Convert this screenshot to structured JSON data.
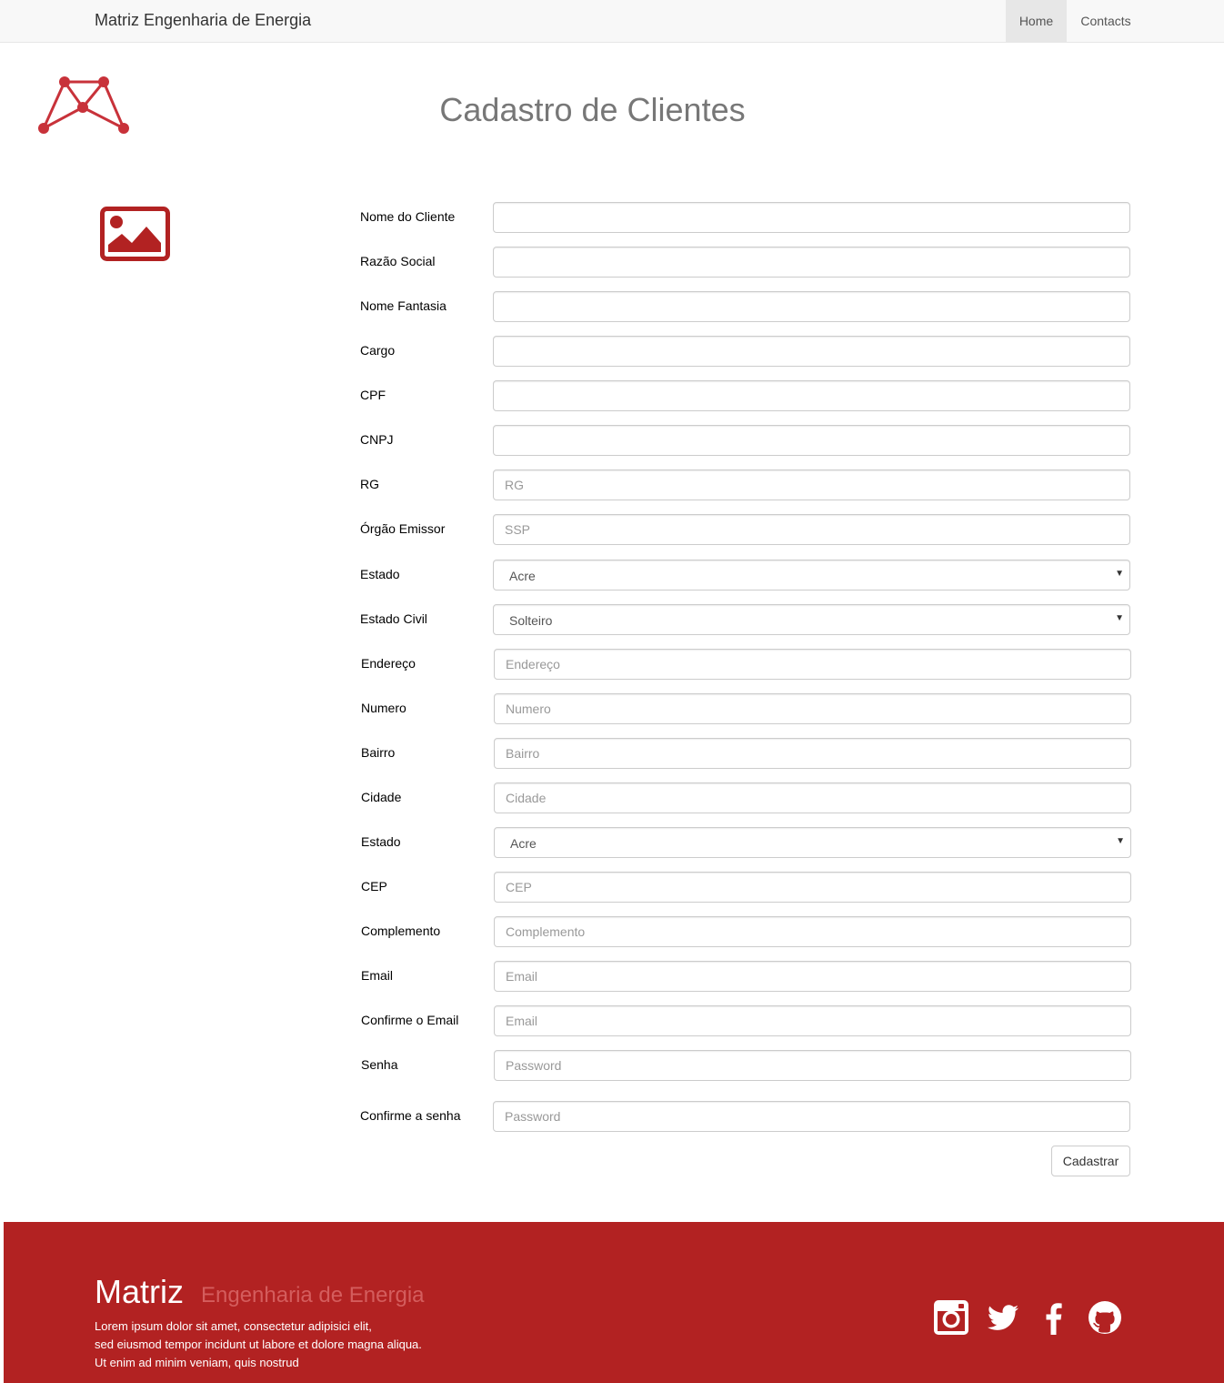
{
  "navbar": {
    "brand": "Matriz Engenharia de Energia",
    "items": [
      {
        "label": "Home",
        "active": true
      },
      {
        "label": "Contacts",
        "active": false
      }
    ]
  },
  "page": {
    "title": "Cadastro de Clientes"
  },
  "form": {
    "fields": [
      {
        "label": "Nome do Cliente",
        "type": "text",
        "value": "",
        "placeholder": ""
      },
      {
        "label": "Razão Social",
        "type": "text",
        "value": "",
        "placeholder": ""
      },
      {
        "label": "Nome Fantasia",
        "type": "text",
        "value": "",
        "placeholder": ""
      },
      {
        "label": "Cargo",
        "type": "text",
        "value": "",
        "placeholder": ""
      },
      {
        "label": "CPF",
        "type": "text",
        "value": "",
        "placeholder": ""
      },
      {
        "label": "CNPJ",
        "type": "text",
        "value": "",
        "placeholder": ""
      },
      {
        "label": "RG",
        "type": "text",
        "value": "",
        "placeholder": "RG"
      },
      {
        "label": "Órgão Emissor",
        "type": "text",
        "value": "",
        "placeholder": "SSP"
      },
      {
        "label": "Estado",
        "type": "select",
        "selected": "Acre"
      },
      {
        "label": "Estado Civil",
        "type": "select",
        "selected": "Solteiro"
      },
      {
        "label": "Endereço",
        "type": "text",
        "value": "",
        "placeholder": "Endereço"
      },
      {
        "label": "Numero",
        "type": "text",
        "value": "",
        "placeholder": "Numero"
      },
      {
        "label": "Bairro",
        "type": "text",
        "value": "",
        "placeholder": "Bairro"
      },
      {
        "label": "Cidade",
        "type": "text",
        "value": "",
        "placeholder": "Cidade"
      },
      {
        "label": "Estado",
        "type": "select",
        "selected": "Acre"
      },
      {
        "label": "CEP",
        "type": "text",
        "value": "",
        "placeholder": "CEP"
      },
      {
        "label": "Complemento",
        "type": "text",
        "value": "",
        "placeholder": "Complemento"
      },
      {
        "label": "Email",
        "type": "text",
        "value": "",
        "placeholder": "Email"
      },
      {
        "label": "Confirme o Email",
        "type": "text",
        "value": "",
        "placeholder": "Email"
      },
      {
        "label": "Senha",
        "type": "password",
        "value": "",
        "placeholder": "Password"
      },
      {
        "label": "Confirme a senha",
        "type": "password",
        "value": "",
        "placeholder": "Password"
      }
    ],
    "submit_label": "Cadastrar"
  },
  "footer": {
    "title": "Matriz",
    "subtitle": "Engenharia de Energia",
    "text_lines": [
      "Lorem ipsum dolor sit amet, consectetur adipisici elit,",
      "sed eiusmod tempor incidunt ut labore et dolore magna aliqua.",
      "Ut enim ad minim veniam, quis nostrud"
    ],
    "social": [
      "instagram-icon",
      "twitter-icon",
      "facebook-icon",
      "github-icon"
    ]
  },
  "colors": {
    "brand_red": "#b22222",
    "logo_red": "#c8323a"
  }
}
